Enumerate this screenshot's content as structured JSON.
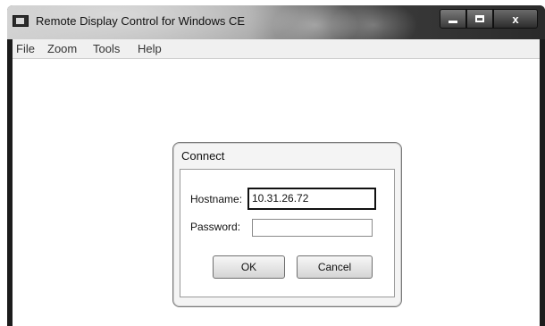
{
  "window": {
    "title": "Remote Display Control for Windows CE",
    "icon": "app-window-icon",
    "controls": [
      "minimize-icon",
      "maximize-icon",
      "close-icon"
    ],
    "close_glyph": "x"
  },
  "menubar": {
    "items": [
      {
        "label": "File"
      },
      {
        "label": "Zoom"
      },
      {
        "label": "Tools"
      },
      {
        "label": "Help"
      }
    ]
  },
  "dialog": {
    "title": "Connect",
    "hostname_label": "Hostname:",
    "hostname_value": "10.31.26.72",
    "password_label": "Password:",
    "password_value": "",
    "ok_label": "OK",
    "cancel_label": "Cancel"
  }
}
